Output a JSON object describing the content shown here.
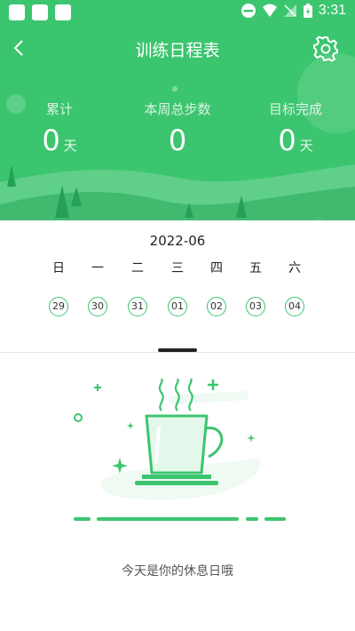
{
  "status_bar": {
    "time": "3:31"
  },
  "header": {
    "title": "训练日程表",
    "stats": [
      {
        "label": "累计",
        "value": "0",
        "unit": "天"
      },
      {
        "label": "本周总步数",
        "value": "0",
        "unit": ""
      },
      {
        "label": "目标完成",
        "value": "0",
        "unit": "天"
      }
    ]
  },
  "calendar": {
    "month": "2022-06",
    "weekdays": [
      "日",
      "一",
      "二",
      "三",
      "四",
      "五",
      "六"
    ],
    "dates": [
      "29",
      "30",
      "31",
      "01",
      "02",
      "03",
      "04"
    ]
  },
  "rest_message": "今天是你的休息日哦",
  "colors": {
    "primary": "#3cc56f",
    "background": "#ffffff"
  },
  "icons": [
    "back-icon",
    "gear-icon",
    "coffee-cup-icon"
  ]
}
